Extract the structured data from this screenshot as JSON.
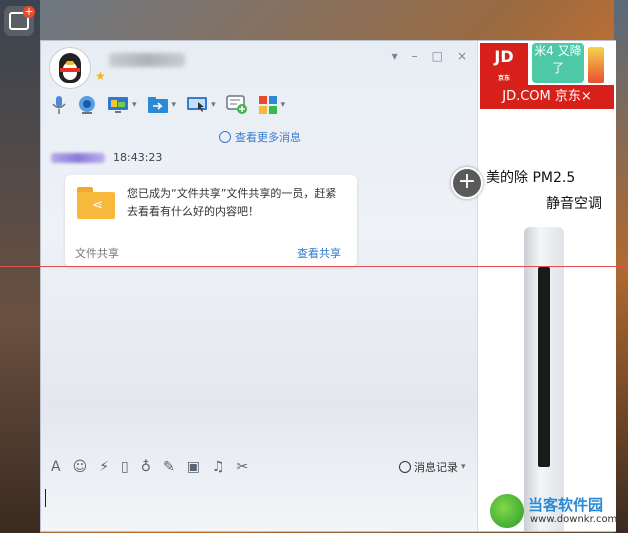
{
  "window": {
    "controls": [
      "▾",
      "–",
      "□",
      "×"
    ]
  },
  "toolbar": {
    "carets": "▾"
  },
  "chat": {
    "more_messages": "查看更多消息",
    "time": "18:43:23",
    "card": {
      "message": "您已成为“文件共享”文件共享的一员，赶紧去看看有什么好的内容吧！",
      "footer_left": "文件共享",
      "footer_right": "查看共享"
    }
  },
  "plus_button": "+",
  "ad": {
    "jd_logo": "JD",
    "jd_logo_sub": "京东",
    "mi_text": "米4 又降了",
    "jd_bar": "JD.COM 京东×",
    "line1": "美的除 PM2.5",
    "line2": "静音空调"
  },
  "input_toolbar": {
    "font_icon": "A",
    "history": "消息记录"
  },
  "watermark": {
    "title": "当客软件园",
    "url": "www.downkr.com"
  }
}
